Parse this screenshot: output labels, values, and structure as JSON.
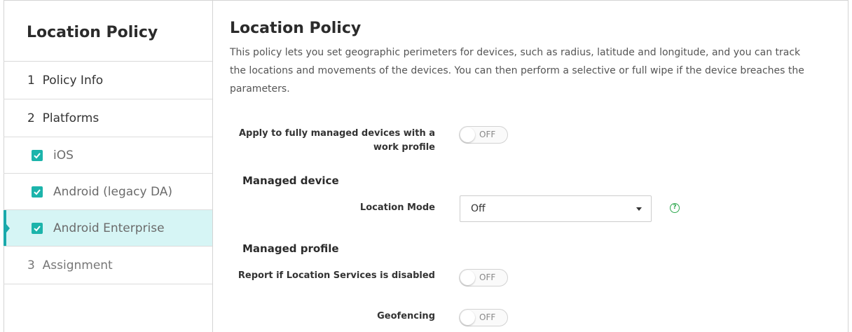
{
  "sidebar": {
    "title": "Location Policy",
    "steps": [
      {
        "label": "1  Policy Info"
      },
      {
        "label": "2  Platforms"
      }
    ],
    "platforms": [
      {
        "label": "iOS",
        "checked": true
      },
      {
        "label": "Android (legacy DA)",
        "checked": true
      },
      {
        "label": "Android Enterprise",
        "checked": true,
        "active": true
      }
    ],
    "assignment": {
      "label": "3  Assignment"
    }
  },
  "main": {
    "title": "Location Policy",
    "description": "This policy lets you set geographic perimeters for devices, such as radius, latitude and longitude, and you can track the locations and movements of the devices. You can then perform a selective or full wipe if the device breaches the parameters.",
    "fully_managed": {
      "label": "Apply to fully managed devices with a work profile",
      "toggle": "OFF"
    },
    "managed_device": {
      "heading": "Managed device",
      "location_mode_label": "Location Mode",
      "location_mode_value": "Off",
      "help_icon": "?"
    },
    "managed_profile": {
      "heading": "Managed profile",
      "report_label": "Report if Location Services is disabled",
      "report_toggle": "OFF",
      "geofencing_label": "Geofencing",
      "geofencing_toggle": "OFF"
    }
  },
  "colors": {
    "accent": "#19a9ab",
    "active_bg": "#d6f5f5",
    "checkbox": "#1cb4ab",
    "help_icon": "#2fa84f"
  }
}
